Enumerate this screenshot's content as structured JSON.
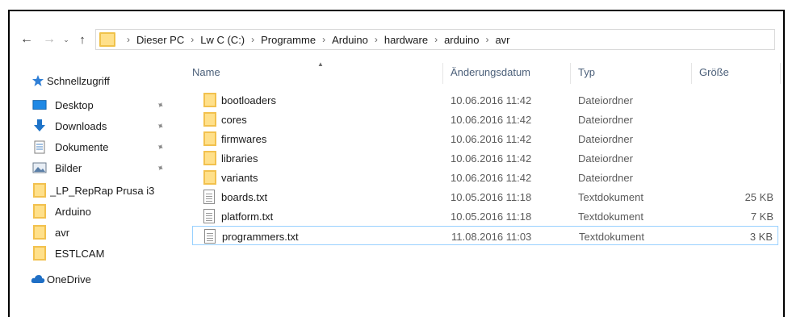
{
  "nav": {
    "back_glyph": "←",
    "forward_glyph": "→",
    "recent_glyph": "⌄",
    "up_glyph": "↑"
  },
  "breadcrumb": [
    "Dieser PC",
    "Lw C (C:)",
    "Programme",
    "Arduino",
    "hardware",
    "arduino",
    "avr"
  ],
  "sidebar": {
    "items": [
      {
        "label": "Schnellzugriff",
        "icon": "star-icon",
        "pinned": false
      },
      {
        "label": "Desktop",
        "icon": "desktop-icon",
        "pinned": true
      },
      {
        "label": "Downloads",
        "icon": "download-arrow-icon",
        "pinned": true
      },
      {
        "label": "Dokumente",
        "icon": "document-icon",
        "pinned": true
      },
      {
        "label": "Bilder",
        "icon": "pictures-icon",
        "pinned": true
      },
      {
        "label": "_LP_RepRap Prusa i3",
        "icon": "folder-icon",
        "pinned": false
      },
      {
        "label": "Arduino",
        "icon": "folder-icon",
        "pinned": false
      },
      {
        "label": "avr",
        "icon": "folder-icon",
        "pinned": false
      },
      {
        "label": "ESTLCAM",
        "icon": "folder-icon",
        "pinned": false
      },
      {
        "label": "OneDrive",
        "icon": "cloud-icon",
        "pinned": false
      }
    ],
    "pin_glyph": "📌"
  },
  "columns": {
    "name": "Name",
    "date": "Änderungsdatum",
    "type": "Typ",
    "size": "Größe"
  },
  "files": [
    {
      "name": "bootloaders",
      "date": "10.06.2016 11:42",
      "type": "Dateiordner",
      "size": "",
      "kind": "folder"
    },
    {
      "name": "cores",
      "date": "10.06.2016 11:42",
      "type": "Dateiordner",
      "size": "",
      "kind": "folder"
    },
    {
      "name": "firmwares",
      "date": "10.06.2016 11:42",
      "type": "Dateiordner",
      "size": "",
      "kind": "folder"
    },
    {
      "name": "libraries",
      "date": "10.06.2016 11:42",
      "type": "Dateiordner",
      "size": "",
      "kind": "folder"
    },
    {
      "name": "variants",
      "date": "10.06.2016 11:42",
      "type": "Dateiordner",
      "size": "",
      "kind": "folder"
    },
    {
      "name": "boards.txt",
      "date": "10.05.2016 11:18",
      "type": "Textdokument",
      "size": "25 KB",
      "kind": "file"
    },
    {
      "name": "platform.txt",
      "date": "10.05.2016 11:18",
      "type": "Textdokument",
      "size": "7 KB",
      "kind": "file"
    },
    {
      "name": "programmers.txt",
      "date": "11.08.2016 11:03",
      "type": "Textdokument",
      "size": "3 KB",
      "kind": "file",
      "selected": true
    }
  ],
  "colors": {
    "folder_fill": "#ffe08a",
    "folder_border": "#f2c14e",
    "header_text": "#4c607a",
    "selection_border": "#99d1ff",
    "star": "#2f7fd6",
    "onedrive": "#1f6fc5"
  }
}
